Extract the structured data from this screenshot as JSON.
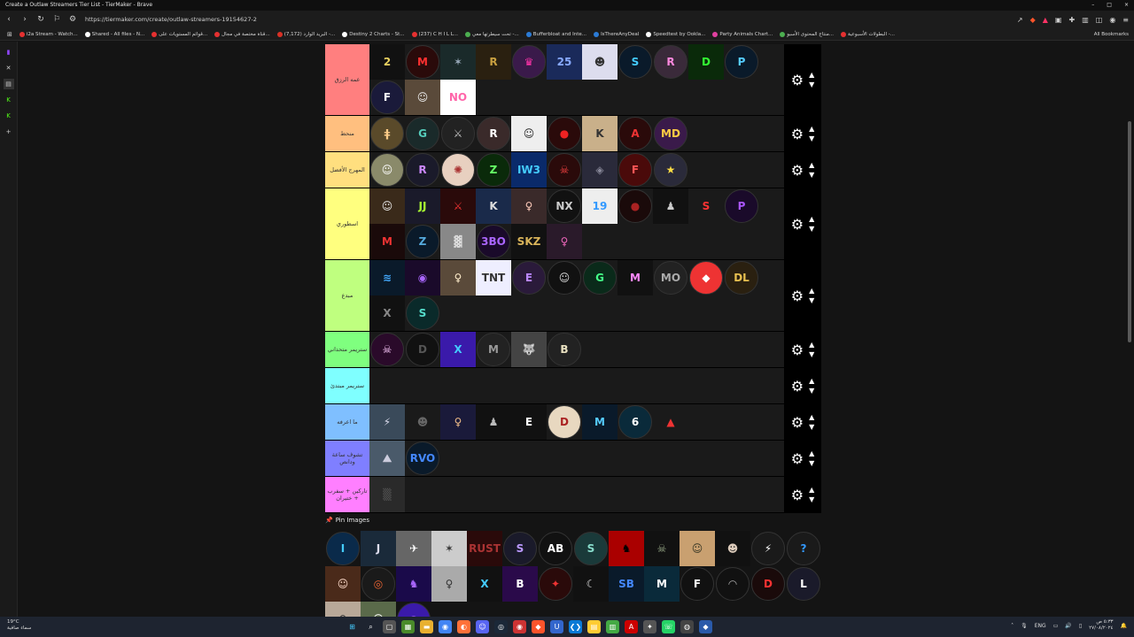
{
  "window": {
    "title": "Create a Outlaw Streamers Tier List - TierMaker - Brave",
    "controls": [
      "–",
      "□",
      "×"
    ]
  },
  "navbar": {
    "url": "https://tiermaker.com/create/outlaw-streamers-19154627-2"
  },
  "bookmarks": {
    "items": [
      {
        "label": "i2a Stream - Watch...",
        "color": "#e63030"
      },
      {
        "label": "Shared - All files - N...",
        "color": "#ffffff"
      },
      {
        "label": "قوائم المستويات على...",
        "color": "#e63030"
      },
      {
        "label": "قناة مختصة في مجال...",
        "color": "#e63030"
      },
      {
        "label": "(7,172) البريد الوارد -...",
        "color": "#d93025"
      },
      {
        "label": "Destiny 2 Charts - St...",
        "color": "#ffffff"
      },
      {
        "label": "(237) C H I L L...",
        "color": "#e63030"
      },
      {
        "label": "تحت سيطرتها معي -...",
        "color": "#4caf50"
      },
      {
        "label": "Bufferbloat and Inte...",
        "color": "#2b7bd6"
      },
      {
        "label": "IsThereAnyDeal",
        "color": "#2b7bd6"
      },
      {
        "label": "Speedtest by Ookla...",
        "color": "#ffffff"
      },
      {
        "label": "Party Animals Chart...",
        "color": "#e040a0"
      },
      {
        "label": "منتاج المحتوى الأسبو...",
        "color": "#4caf50"
      },
      {
        "label": "البطولات الأسبوعية -...",
        "color": "#e63030"
      }
    ],
    "all_bookmarks": "All Bookmarks"
  },
  "tiers": [
    {
      "label": "عمه الرزق",
      "color": "#ff7f7f",
      "rows": 2,
      "items": [
        {
          "t": "2",
          "bg": "#111",
          "fg": "#e8d060",
          "shape": "sq"
        },
        {
          "t": "M",
          "bg": "#2a0a0a",
          "fg": "#ff3030",
          "shape": "av"
        },
        {
          "t": "✶",
          "bg": "#1a2a2a",
          "fg": "#9ab",
          "shape": "sq"
        },
        {
          "t": "R",
          "bg": "#2a2010",
          "fg": "#c9a040",
          "shape": "sq"
        },
        {
          "t": "♛",
          "bg": "#3a1a4a",
          "fg": "#f3a",
          "shape": "av"
        },
        {
          "t": "25",
          "bg": "#1a2a5a",
          "fg": "#8af",
          "shape": "sq"
        },
        {
          "t": "☻",
          "bg": "#dde",
          "fg": "#333",
          "shape": "sq"
        },
        {
          "t": "S",
          "bg": "#0a1a2a",
          "fg": "#4cf",
          "shape": "av"
        },
        {
          "t": "R",
          "bg": "#3a2a3a",
          "fg": "#f8d",
          "shape": "av"
        },
        {
          "t": "D",
          "bg": "#0a2a0a",
          "fg": "#3f3",
          "shape": "sq"
        },
        {
          "t": "P",
          "bg": "#0a1a2a",
          "fg": "#5cf",
          "shape": "av"
        },
        {
          "t": "F",
          "bg": "#1a1a3a",
          "fg": "#fff",
          "shape": "av"
        },
        {
          "t": "☺",
          "bg": "#5a4a3a",
          "fg": "#eee",
          "shape": "sq"
        },
        {
          "t": "NO",
          "bg": "#fff",
          "fg": "#f6a",
          "shape": "sq"
        }
      ]
    },
    {
      "label": "منحط",
      "color": "#ffbf7f",
      "rows": 1,
      "items": [
        {
          "t": "ǂ",
          "bg": "#5a4a2a",
          "fg": "#fc8",
          "shape": "av"
        },
        {
          "t": "G",
          "bg": "#1a2a2a",
          "fg": "#5cb",
          "shape": "av"
        },
        {
          "t": "⚔",
          "bg": "#222",
          "fg": "#bbb",
          "shape": "av"
        },
        {
          "t": "R",
          "bg": "#3a2a2a",
          "fg": "#fff",
          "shape": "av"
        },
        {
          "t": "☺",
          "bg": "#eee",
          "fg": "#222",
          "shape": "sq"
        },
        {
          "t": "●",
          "bg": "#2a0a0a",
          "fg": "#e22",
          "shape": "av"
        },
        {
          "t": "K",
          "bg": "#c9b08a",
          "fg": "#333",
          "shape": "sq"
        },
        {
          "t": "A",
          "bg": "#2a0a0a",
          "fg": "#e33",
          "shape": "av"
        },
        {
          "t": "MD",
          "bg": "#3a1a4a",
          "fg": "#fc4",
          "shape": "av"
        }
      ]
    },
    {
      "label": "المهرج الأفضل",
      "color": "#ffdf7f",
      "rows": 1,
      "items": [
        {
          "t": "☺",
          "bg": "#8a8a6a",
          "fg": "#fff",
          "shape": "av"
        },
        {
          "t": "R",
          "bg": "#1a1a2a",
          "fg": "#c8f",
          "shape": "av"
        },
        {
          "t": "✺",
          "bg": "#e8d0c0",
          "fg": "#a33",
          "shape": "av"
        },
        {
          "t": "Z",
          "bg": "#0a2a0a",
          "fg": "#6f6",
          "shape": "av"
        },
        {
          "t": "IW3",
          "bg": "#0a2a6a",
          "fg": "#4cf",
          "shape": "sq"
        },
        {
          "t": "☠",
          "bg": "#2a0a0a",
          "fg": "#f44",
          "shape": "av"
        },
        {
          "t": "◈",
          "bg": "#2a2a3a",
          "fg": "#889",
          "shape": "sq"
        },
        {
          "t": "F",
          "bg": "#4a0a0a",
          "fg": "#f55",
          "shape": "av"
        },
        {
          "t": "★",
          "bg": "#2a2a3a",
          "fg": "#fd4",
          "shape": "av"
        }
      ]
    },
    {
      "label": "اسطوري",
      "color": "#ffff7f",
      "rows": 2,
      "items": [
        {
          "t": "☺",
          "bg": "#3a2a1a",
          "fg": "#eee",
          "shape": "sq"
        },
        {
          "t": "JJ",
          "bg": "#1a1a2a",
          "fg": "#af3",
          "shape": "sq"
        },
        {
          "t": "⚔",
          "bg": "#2a0a0a",
          "fg": "#e33",
          "shape": "sq"
        },
        {
          "t": "K",
          "bg": "#1a2a4a",
          "fg": "#ddd",
          "shape": "sq"
        },
        {
          "t": "♀",
          "bg": "#3a2a2a",
          "fg": "#fcb",
          "shape": "sq"
        },
        {
          "t": "NX",
          "bg": "#111",
          "fg": "#ccc",
          "shape": "av"
        },
        {
          "t": "19",
          "bg": "#eee",
          "fg": "#39f",
          "shape": "sq"
        },
        {
          "t": "●",
          "bg": "#1a0a0a",
          "fg": "#a22",
          "shape": "av"
        },
        {
          "t": "♟",
          "bg": "#111",
          "fg": "#ccc",
          "shape": "sq"
        },
        {
          "t": "S",
          "bg": "#1a1a1a",
          "fg": "#f33",
          "shape": "sq"
        },
        {
          "t": "P",
          "bg": "#1a0a2a",
          "fg": "#a5f",
          "shape": "av"
        },
        {
          "t": "M",
          "bg": "#1a0a0a",
          "fg": "#e33",
          "shape": "sq"
        },
        {
          "t": "Z",
          "bg": "#0a1a2a",
          "fg": "#5ad",
          "shape": "av"
        },
        {
          "t": "▓",
          "bg": "#888",
          "fg": "#ddd",
          "shape": "sq"
        },
        {
          "t": "3BO",
          "bg": "#1a0a2a",
          "fg": "#a6f",
          "shape": "av"
        },
        {
          "t": "SKZ",
          "bg": "#111",
          "fg": "#d9b45a",
          "shape": "sq"
        },
        {
          "t": "♀",
          "bg": "#2a1a2a",
          "fg": "#e6b",
          "shape": "sq"
        }
      ]
    },
    {
      "label": "مبدع",
      "color": "#bfff7f",
      "rows": 2,
      "items": [
        {
          "t": "≋",
          "bg": "#0a1a2a",
          "fg": "#4af",
          "shape": "sq"
        },
        {
          "t": "◉",
          "bg": "#1a0a2a",
          "fg": "#a6f",
          "shape": "sq"
        },
        {
          "t": "♀",
          "bg": "#5a4a3a",
          "fg": "#fec",
          "shape": "sq"
        },
        {
          "t": "TNT",
          "bg": "#eef",
          "fg": "#333",
          "shape": "sq"
        },
        {
          "t": "E",
          "bg": "#2a1a3a",
          "fg": "#b8f",
          "shape": "av"
        },
        {
          "t": "☺",
          "bg": "#111",
          "fg": "#ddd",
          "shape": "av"
        },
        {
          "t": "G",
          "bg": "#0a2a1a",
          "fg": "#4f8",
          "shape": "av"
        },
        {
          "t": "M",
          "bg": "#111",
          "fg": "#f8f",
          "shape": "sq"
        },
        {
          "t": "MO",
          "bg": "#222",
          "fg": "#aaa",
          "shape": "av"
        },
        {
          "t": "◆",
          "bg": "#e33",
          "fg": "#fff",
          "shape": "av"
        },
        {
          "t": "DL",
          "bg": "#2a2010",
          "fg": "#e8c050",
          "shape": "av"
        },
        {
          "t": "X",
          "bg": "#111",
          "fg": "#888",
          "shape": "sq"
        },
        {
          "t": "S",
          "bg": "#0a2a2a",
          "fg": "#5dc",
          "shape": "av"
        }
      ]
    },
    {
      "label": "ستريمر متحداني",
      "color": "#7fff7f",
      "rows": 1,
      "items": [
        {
          "t": "☠",
          "bg": "#2a0a2a",
          "fg": "#fcf",
          "shape": "av"
        },
        {
          "t": "D",
          "bg": "#111",
          "fg": "#555",
          "shape": "av"
        },
        {
          "t": "X",
          "bg": "#3a1aaa",
          "fg": "#4cf",
          "shape": "sq"
        },
        {
          "t": "M",
          "bg": "#222",
          "fg": "#999",
          "shape": "av"
        },
        {
          "t": "🐺",
          "bg": "#444",
          "fg": "#ddd",
          "shape": "sq"
        },
        {
          "t": "B",
          "bg": "#222",
          "fg": "#e8e0c0",
          "shape": "av"
        }
      ]
    },
    {
      "label": "ستريمر مبتدئ",
      "color": "#7fffff",
      "rows": 1,
      "items": []
    },
    {
      "label": "ما اعرفه",
      "color": "#7fbfff",
      "rows": 1,
      "items": [
        {
          "t": "⚡",
          "bg": "#3a4a5a",
          "fg": "#dde",
          "shape": "sq"
        },
        {
          "t": "☻",
          "bg": "#1a1a1a",
          "fg": "#666",
          "shape": "sq"
        },
        {
          "t": "♀",
          "bg": "#1a1a3a",
          "fg": "#eb8",
          "shape": "sq"
        },
        {
          "t": "♟",
          "bg": "#111",
          "fg": "#bbb",
          "shape": "sq"
        },
        {
          "t": "E",
          "bg": "#111",
          "fg": "#fff",
          "shape": "sq"
        },
        {
          "t": "D",
          "bg": "#e8d8c0",
          "fg": "#a22",
          "shape": "av"
        },
        {
          "t": "M",
          "bg": "#0a1a2a",
          "fg": "#5cf",
          "shape": "sq"
        },
        {
          "t": "6",
          "bg": "#0a2a3a",
          "fg": "#fff",
          "shape": "av"
        },
        {
          "t": "▲",
          "bg": "#1a1a1a",
          "fg": "#e33",
          "shape": "sq"
        }
      ]
    },
    {
      "label": "تشوف ساعة ودانص",
      "color": "#7f7fff",
      "rows": 1,
      "items": [
        {
          "t": "⛰",
          "bg": "#4a5a6a",
          "fg": "#ccd",
          "shape": "sq"
        },
        {
          "t": "RVO",
          "bg": "#0a1a2a",
          "fg": "#48f",
          "shape": "av"
        }
      ]
    },
    {
      "label": "تاركين + سفرب + ختيران",
      "color": "#ff7fff",
      "rows": 1,
      "items": [
        {
          "t": "▒",
          "bg": "#2a2a2a",
          "fg": "#555",
          "shape": "sq"
        }
      ]
    }
  ],
  "pin": {
    "label": "Pin Images"
  },
  "bank": [
    {
      "t": "I",
      "bg": "#0a2a4a",
      "fg": "#4cf",
      "shape": "av"
    },
    {
      "t": "J",
      "bg": "#1a2a3a",
      "fg": "#dde",
      "shape": "sq"
    },
    {
      "t": "✈",
      "bg": "#666",
      "fg": "#fff",
      "shape": "sq"
    },
    {
      "t": "✶",
      "bg": "#ccc",
      "fg": "#333",
      "shape": "sq"
    },
    {
      "t": "RUST",
      "bg": "#2a0a0a",
      "fg": "#a33",
      "shape": "sq"
    },
    {
      "t": "S",
      "bg": "#1a1a2a",
      "fg": "#b9f",
      "shape": "av"
    },
    {
      "t": "AB",
      "bg": "#111",
      "fg": "#fff",
      "shape": "av"
    },
    {
      "t": "S",
      "bg": "#1a3a3a",
      "fg": "#8dc",
      "shape": "av"
    },
    {
      "t": "♞",
      "bg": "#a00",
      "fg": "#000",
      "shape": "sq"
    },
    {
      "t": "☠",
      "bg": "#111",
      "fg": "#9a8",
      "shape": "sq"
    },
    {
      "t": "☺",
      "bg": "#c9a070",
      "fg": "#332",
      "shape": "sq"
    },
    {
      "t": "☻",
      "bg": "#111",
      "fg": "#dcb",
      "shape": "sq"
    },
    {
      "t": "⚡",
      "bg": "#1a1a1a",
      "fg": "#fff",
      "shape": "av"
    },
    {
      "t": "?",
      "bg": "#1a1a1a",
      "fg": "#39f",
      "shape": "av"
    },
    {
      "t": "☺",
      "bg": "#4a2a1a",
      "fg": "#fdc",
      "shape": "sq"
    },
    {
      "t": "◎",
      "bg": "#1a1a1a",
      "fg": "#e63",
      "shape": "av"
    },
    {
      "t": "♞",
      "bg": "#1a0a4a",
      "fg": "#a6f",
      "shape": "sq"
    },
    {
      "t": "♀",
      "bg": "#aaa",
      "fg": "#333",
      "shape": "sq"
    },
    {
      "t": "X",
      "bg": "#111",
      "fg": "#4cf",
      "shape": "sq"
    },
    {
      "t": "B",
      "bg": "#2a0a4a",
      "fg": "#fff",
      "shape": "sq"
    },
    {
      "t": "✦",
      "bg": "#2a0a0a",
      "fg": "#e33",
      "shape": "av"
    },
    {
      "t": "☾",
      "bg": "#111",
      "fg": "#ddd",
      "shape": "sq"
    },
    {
      "t": "SB",
      "bg": "#0a1a2a",
      "fg": "#48f",
      "shape": "sq"
    },
    {
      "t": "M",
      "bg": "#0a2a3a",
      "fg": "#fff",
      "shape": "sq"
    },
    {
      "t": "F",
      "bg": "#111",
      "fg": "#fff",
      "shape": "av"
    },
    {
      "t": "◠",
      "bg": "#111",
      "fg": "#aaa",
      "shape": "av"
    },
    {
      "t": "D",
      "bg": "#1a0a0a",
      "fg": "#f33",
      "shape": "av"
    },
    {
      "t": "L",
      "bg": "#1a1a2a",
      "fg": "#fff",
      "shape": "av"
    },
    {
      "t": "♀",
      "bg": "#b8a898",
      "fg": "#333",
      "shape": "sq"
    },
    {
      "t": "☺",
      "bg": "#5a6a4a",
      "fg": "#fff",
      "shape": "sq"
    },
    {
      "t": "◔",
      "bg": "#3a1aaa",
      "fg": "#a6f",
      "shape": "av"
    }
  ],
  "taskbar": {
    "weather_temp": "19°C",
    "weather_desc": "سماء صافية",
    "lang": "ENG",
    "time": "٥:٣٣ ص",
    "date": "٢٧/٠٨/٢٠٢٤"
  }
}
